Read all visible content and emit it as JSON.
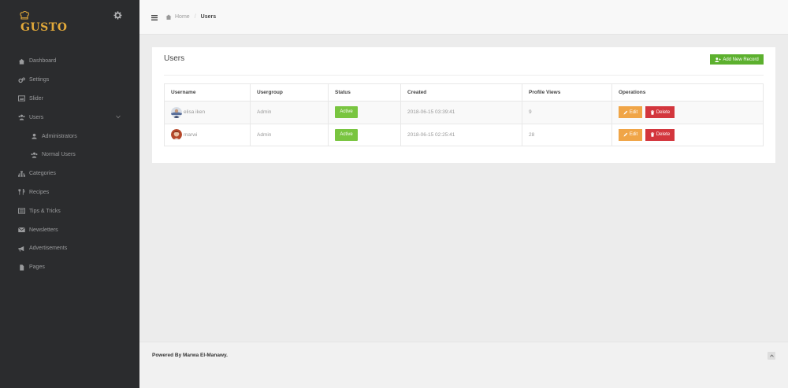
{
  "app": {
    "logo_text": "GUSTO",
    "brand_color": "#e2a93a"
  },
  "sidebar": {
    "items": [
      {
        "label": "Dashboard",
        "icon": "dashboard-icon"
      },
      {
        "label": "Settings",
        "icon": "cogs-icon"
      },
      {
        "label": "Slider",
        "icon": "image-icon"
      },
      {
        "label": "Users",
        "icon": "users-icon",
        "expanded": true
      },
      {
        "label": "Administrators",
        "icon": "user-secret-icon"
      },
      {
        "label": "Normal Users",
        "icon": "users-icon"
      },
      {
        "label": "Categories",
        "icon": "sitemap-icon"
      },
      {
        "label": "Recipes",
        "icon": "cutlery-icon"
      },
      {
        "label": "Tips & Tricks",
        "icon": "list-alt-icon"
      },
      {
        "label": "Newsletters",
        "icon": "envelope-icon"
      },
      {
        "label": "Advertisements",
        "icon": "bullhorn-icon"
      },
      {
        "label": "Pages",
        "icon": "file-icon"
      }
    ]
  },
  "breadcrumb": {
    "home": "Home",
    "current": "Users"
  },
  "panel": {
    "title": "Users",
    "add_button": "Add New Record"
  },
  "table": {
    "headers": [
      "Username",
      "Usergroup",
      "Status",
      "Created",
      "Profile Views",
      "Operations"
    ],
    "rows": [
      {
        "username": "elisa iken",
        "usergroup": "Admin",
        "status": "Active",
        "created": "2018-06-15 03:39:41",
        "views": "9",
        "edit": "Edit",
        "delete": "Delete"
      },
      {
        "username": "marwi",
        "usergroup": "Admin",
        "status": "Active",
        "created": "2018-06-15 02:25:41",
        "views": "28",
        "edit": "Edit",
        "delete": "Delete"
      }
    ]
  },
  "footer": {
    "text": "Powered By Marwa El-Manawy."
  },
  "colors": {
    "sidebar_bg": "#2b2c2e",
    "success": "#5cb02e",
    "active_badge": "#79c540",
    "edit": "#f0a547",
    "delete": "#d3363d"
  }
}
